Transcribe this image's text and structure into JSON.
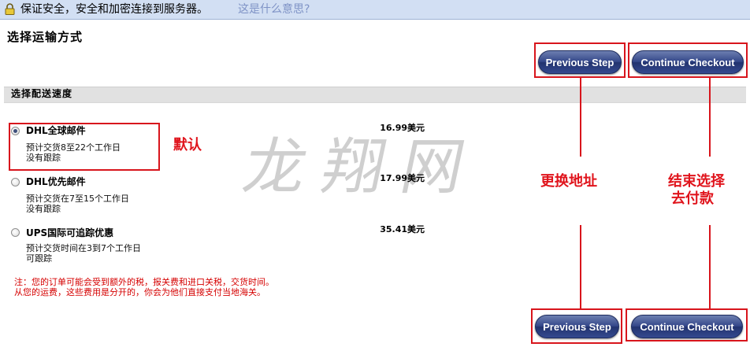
{
  "banner": {
    "secure_text": "保证安全，安全和加密连接到服务器。",
    "what_link": "这是什么意思?"
  },
  "page_title": "选择运输方式",
  "buttons": {
    "previous": "Previous Step",
    "continue": "Continue Checkout"
  },
  "section_title": "选择配送速度",
  "options": [
    {
      "name": "DHL全球邮件",
      "desc1": "预计交货8至22个工作日",
      "desc2": "没有跟踪",
      "price": "16.99美元",
      "selected": true
    },
    {
      "name": "DHL优先邮件",
      "desc1": "预计交货在7至15个工作日",
      "desc2": "没有跟踪",
      "price": "17.99美元",
      "selected": false
    },
    {
      "name": "UPS国际可追踪优惠",
      "desc1": "预计交货时间在3到7个工作日",
      "desc2": "可跟踪",
      "price": "35.41美元",
      "selected": false
    }
  ],
  "note": {
    "line1": "注：您的订单可能会受到额外的税，报关费和进口关税，交货时间。",
    "line2": "从您的运费，这些费用是分开的，你会为他们直接支付当地海关。"
  },
  "annotations": {
    "default": "默认",
    "change_address": "更换地址",
    "finish_line1": "结束选择",
    "finish_line2": "去付款"
  },
  "watermark": "龙翔网",
  "colors": {
    "banner_bg": "#d2dff3",
    "link": "#7f93c6",
    "button": "#2f4383",
    "annotation_red": "#d8151c",
    "note_red": "#d50000",
    "section_header_bg": "#e1e1e1"
  }
}
